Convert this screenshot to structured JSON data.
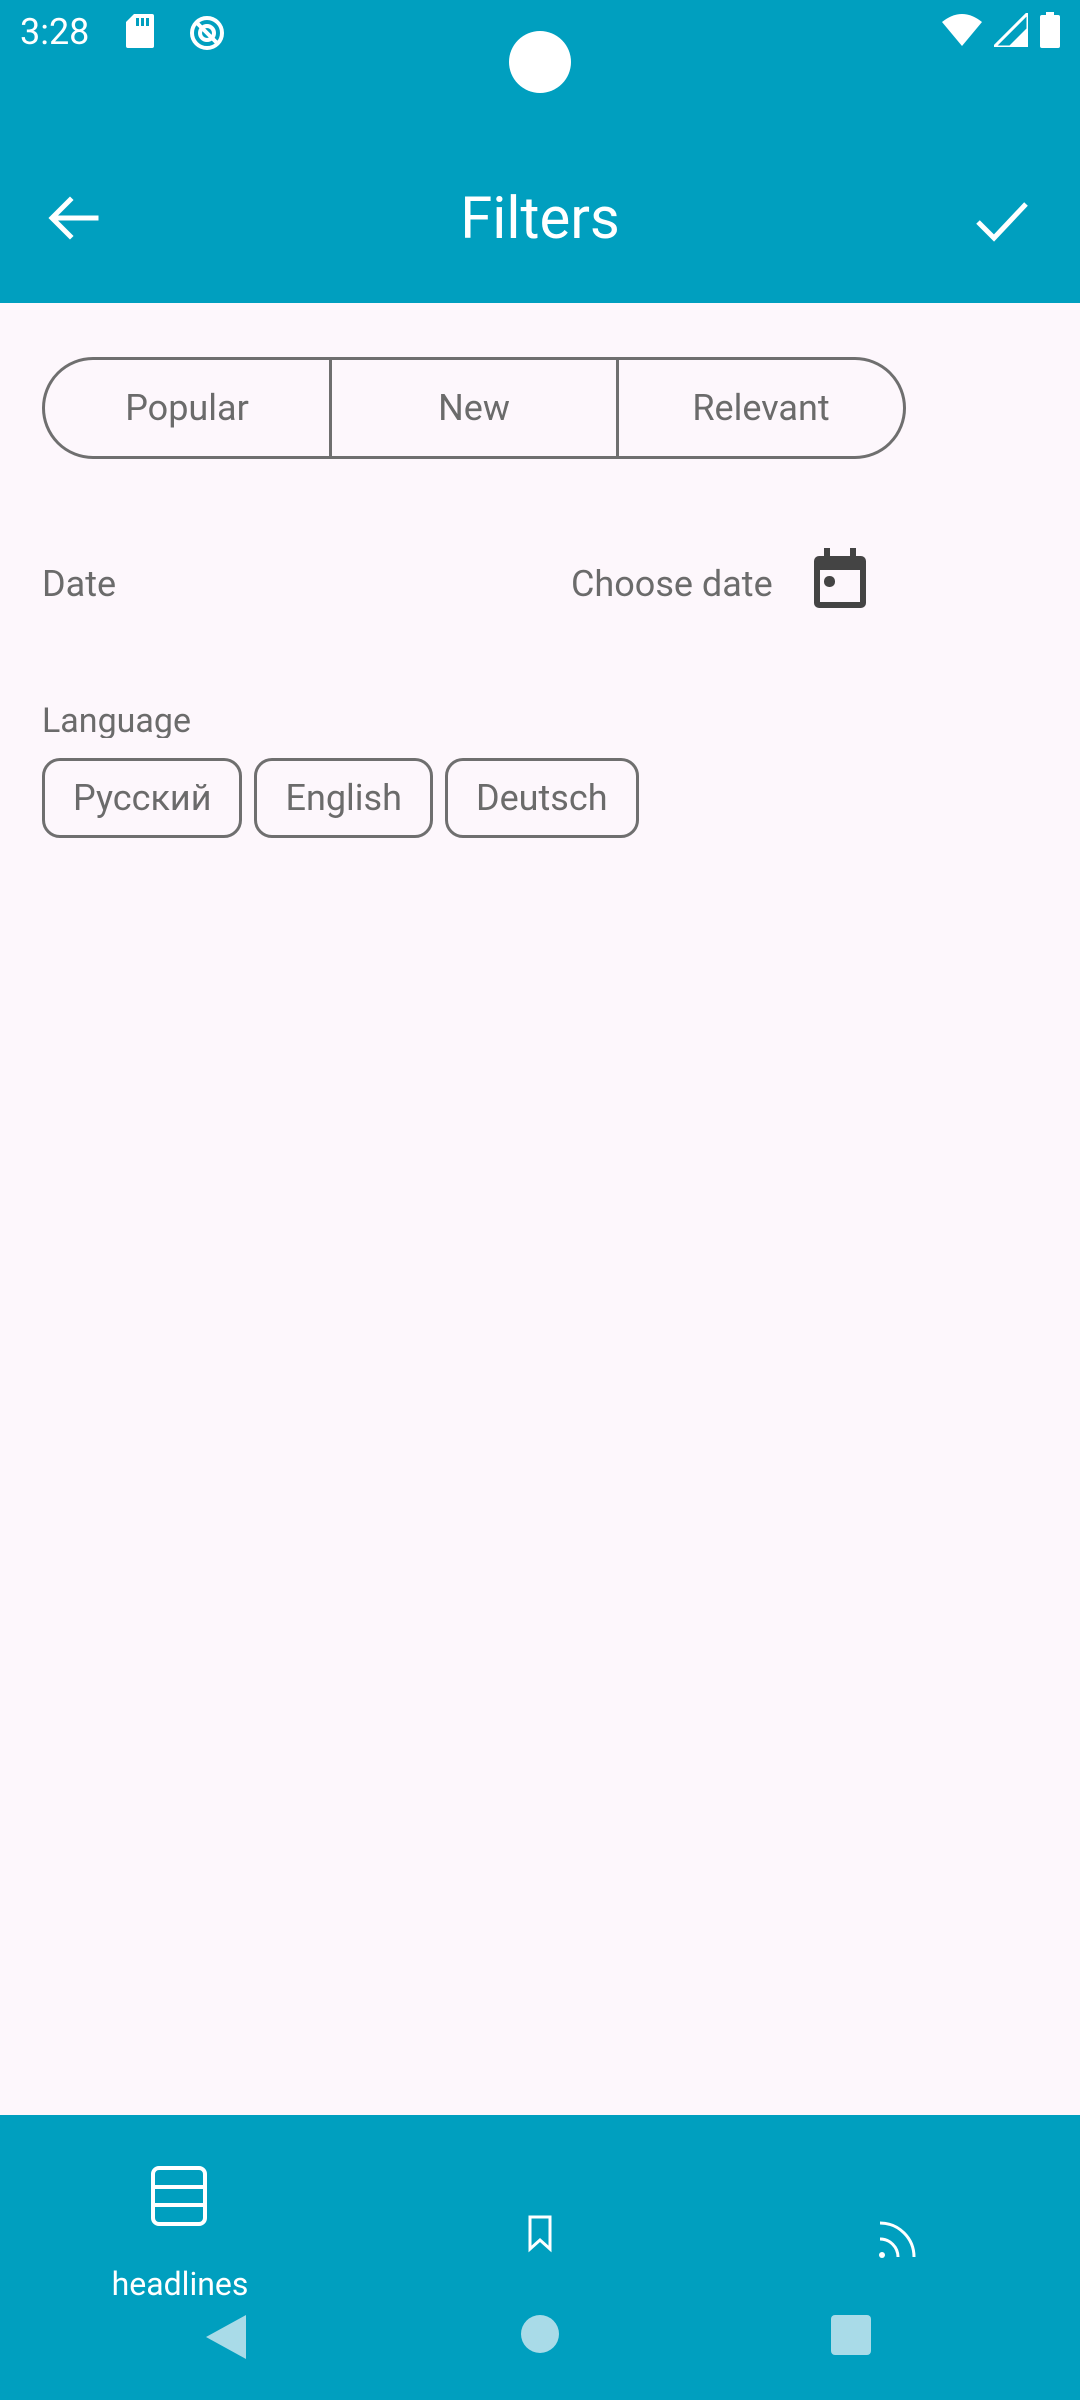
{
  "status_bar": {
    "time": "3:28",
    "icons_left": [
      "sd-card-icon",
      "sync-icon"
    ],
    "icons_right": [
      "wifi-icon",
      "signal-icon",
      "battery-icon"
    ]
  },
  "app_bar": {
    "title": "Filters",
    "back_icon": "arrow-back-icon",
    "confirm_icon": "check-icon"
  },
  "sort": {
    "options": [
      "Popular",
      "New",
      "Relevant"
    ]
  },
  "date": {
    "label": "Date",
    "choose_label": "Choose date",
    "icon": "calendar-icon"
  },
  "language": {
    "label": "Language",
    "chips": [
      "Русский",
      "English",
      "Deutsch"
    ]
  },
  "bottom_nav": {
    "items": [
      {
        "label": "headlines",
        "icon": "headlines-icon"
      },
      {
        "icon": "bookmark-icon"
      },
      {
        "icon": "rss-icon"
      }
    ]
  },
  "colors": {
    "primary": "#009fbf",
    "background": "#fdf7fc",
    "outline": "#6f6f6f",
    "text_secondary": "#6b6b6b"
  }
}
